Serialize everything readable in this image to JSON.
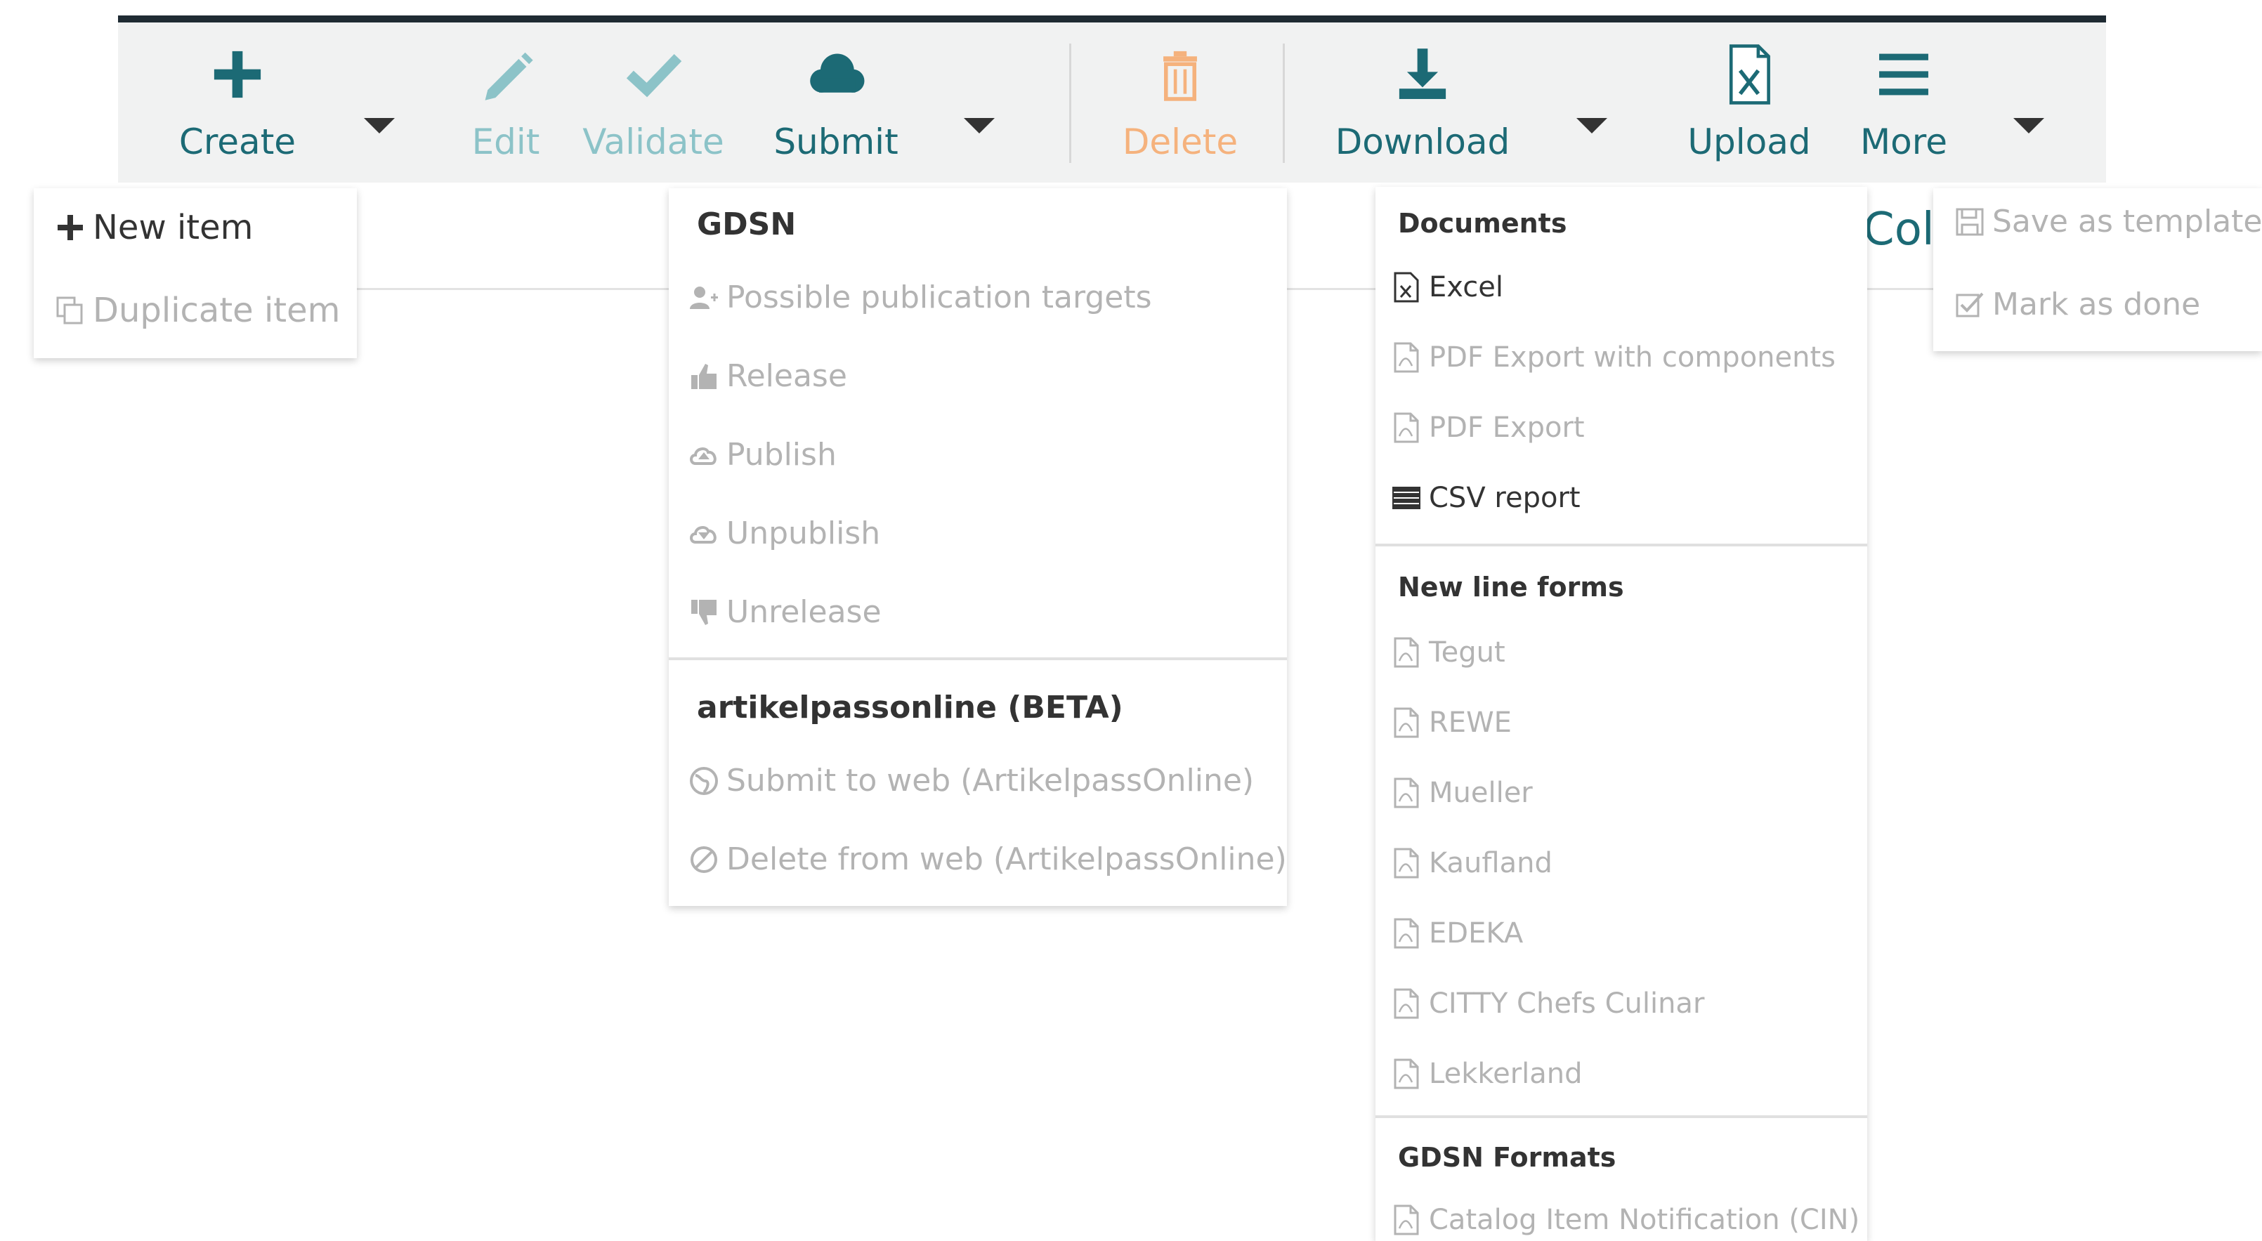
{
  "toolbar": {
    "create_label": "Create",
    "edit_label": "Edit",
    "validate_label": "Validate",
    "submit_label": "Submit",
    "delete_label": "Delete",
    "download_label": "Download",
    "upload_label": "Upload",
    "more_label": "More"
  },
  "create_menu": {
    "items": [
      {
        "label": "New item",
        "icon": "plus-icon"
      },
      {
        "label": "Duplicate item",
        "icon": "duplicate-icon"
      }
    ]
  },
  "submit_menu": {
    "sections": [
      {
        "header": "GDSN",
        "items": [
          {
            "label": "Possible publication targets",
            "icon": "add-user-icon"
          },
          {
            "label": "Release",
            "icon": "thumbs-up-icon"
          },
          {
            "label": "Publish",
            "icon": "cloud-upload-icon"
          },
          {
            "label": "Unpublish",
            "icon": "cloud-download-icon"
          },
          {
            "label": "Unrelease",
            "icon": "thumbs-down-icon"
          }
        ]
      },
      {
        "header": "artikelpassonline (BETA)",
        "items": [
          {
            "label": "Submit to web (ArtikelpassOnline)",
            "icon": "globe-icon"
          },
          {
            "label": "Delete from web (ArtikelpassOnline)",
            "icon": "ban-icon"
          }
        ]
      }
    ]
  },
  "download_menu": {
    "sections": [
      {
        "header": "Documents",
        "items": [
          {
            "label": "Excel",
            "icon": "excel-file-icon"
          },
          {
            "label": "PDF Export with components",
            "icon": "pdf-file-icon"
          },
          {
            "label": "PDF Export",
            "icon": "pdf-file-icon"
          },
          {
            "label": "CSV report",
            "icon": "table-list-icon"
          }
        ]
      },
      {
        "header": "New line forms",
        "items": [
          {
            "label": "Tegut",
            "icon": "pdf-file-icon"
          },
          {
            "label": "REWE",
            "icon": "pdf-file-icon"
          },
          {
            "label": "Mueller",
            "icon": "pdf-file-icon"
          },
          {
            "label": "Kaufland",
            "icon": "pdf-file-icon"
          },
          {
            "label": "EDEKA",
            "icon": "pdf-file-icon"
          },
          {
            "label": "CITTY Chefs Culinar",
            "icon": "pdf-file-icon"
          },
          {
            "label": "Lekkerland",
            "icon": "pdf-file-icon"
          }
        ]
      },
      {
        "header": "GDSN Formats",
        "items": [
          {
            "label": "Catalog Item Notification (CIN)",
            "icon": "pdf-file-icon"
          }
        ]
      }
    ]
  },
  "more_menu": {
    "items": [
      {
        "label": "Save as template",
        "icon": "floppy-disk-icon"
      },
      {
        "label": "Mark as done",
        "icon": "checkbox-icon"
      }
    ]
  },
  "background_fragment": "Col",
  "colors": {
    "toolbar_bg": "#f1f2f2",
    "teal": "#1c6a75",
    "teal_light": "#8cc3c8",
    "orange_light": "#f5b27d",
    "disabled_text": "#b3b3b3",
    "topbar": "#1f2b33"
  }
}
